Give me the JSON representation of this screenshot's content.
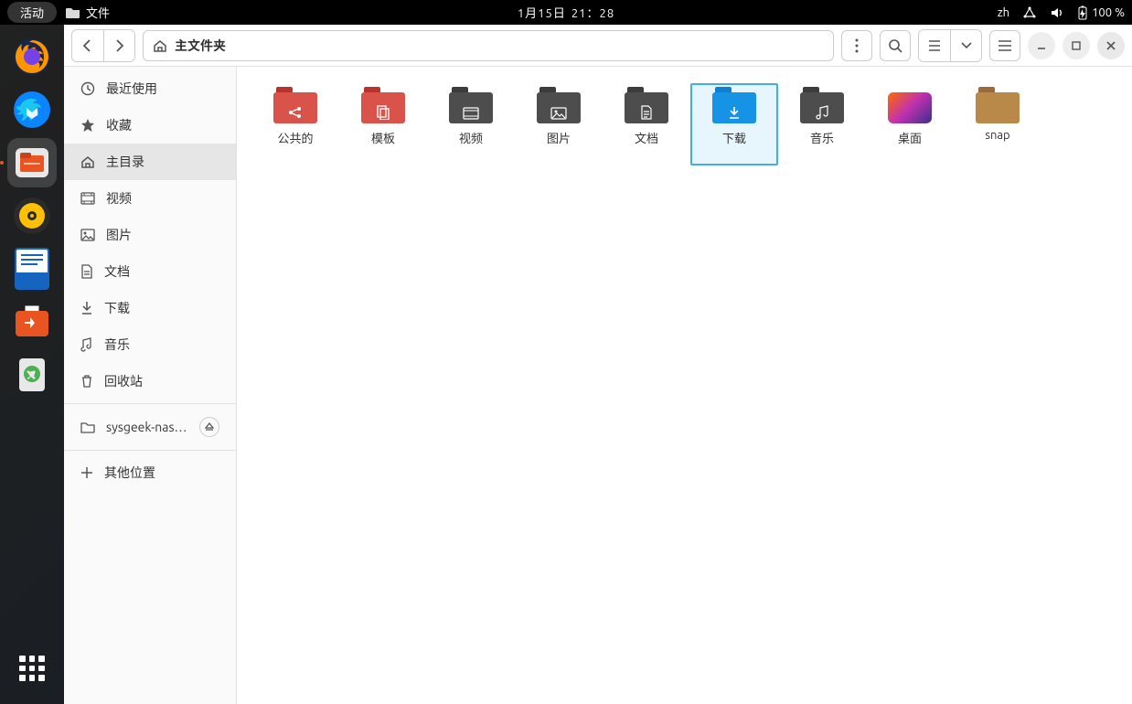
{
  "panel": {
    "activities": "活动",
    "app_name": "文件",
    "date": "1月15日",
    "time": "21：28",
    "lang": "zh",
    "battery": "100 %"
  },
  "window": {
    "path_label": "主文件夹"
  },
  "sidebar": {
    "items": [
      {
        "id": "recent",
        "label": "最近使用"
      },
      {
        "id": "starred",
        "label": "收藏"
      },
      {
        "id": "home",
        "label": "主目录",
        "active": true
      },
      {
        "id": "videos",
        "label": "视频"
      },
      {
        "id": "pictures",
        "label": "图片"
      },
      {
        "id": "documents",
        "label": "文档"
      },
      {
        "id": "downloads",
        "label": "下载"
      },
      {
        "id": "music",
        "label": "音乐"
      },
      {
        "id": "trash",
        "label": "回收站"
      }
    ],
    "mount": {
      "label": "sysgeek-nas.l…"
    },
    "other": {
      "label": "其他位置"
    }
  },
  "folders": [
    {
      "id": "public",
      "label": "公共的",
      "style": "red",
      "glyph": "share"
    },
    {
      "id": "templates",
      "label": "模板",
      "style": "red",
      "glyph": "templates"
    },
    {
      "id": "videos",
      "label": "视频",
      "style": "gray",
      "glyph": "video"
    },
    {
      "id": "pictures",
      "label": "图片",
      "style": "gray",
      "glyph": "image"
    },
    {
      "id": "documents",
      "label": "文档",
      "style": "gray",
      "glyph": "doc"
    },
    {
      "id": "downloads",
      "label": "下载",
      "style": "blue",
      "glyph": "download",
      "selected": true
    },
    {
      "id": "music",
      "label": "音乐",
      "style": "gray",
      "glyph": "music"
    },
    {
      "id": "desktop",
      "label": "桌面",
      "style": "gradient",
      "glyph": ""
    },
    {
      "id": "snap",
      "label": "snap",
      "style": "plain",
      "glyph": ""
    }
  ]
}
